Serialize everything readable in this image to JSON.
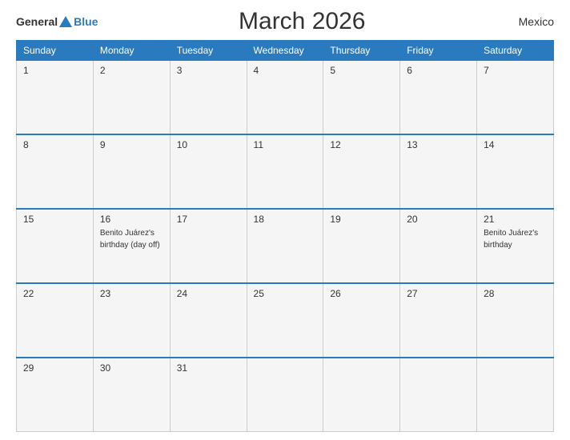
{
  "header": {
    "logo_general": "General",
    "logo_blue": "Blue",
    "title": "March 2026",
    "country": "Mexico"
  },
  "days_of_week": [
    "Sunday",
    "Monday",
    "Tuesday",
    "Wednesday",
    "Thursday",
    "Friday",
    "Saturday"
  ],
  "weeks": [
    [
      {
        "day": "1",
        "event": ""
      },
      {
        "day": "2",
        "event": ""
      },
      {
        "day": "3",
        "event": ""
      },
      {
        "day": "4",
        "event": ""
      },
      {
        "day": "5",
        "event": ""
      },
      {
        "day": "6",
        "event": ""
      },
      {
        "day": "7",
        "event": ""
      }
    ],
    [
      {
        "day": "8",
        "event": ""
      },
      {
        "day": "9",
        "event": ""
      },
      {
        "day": "10",
        "event": ""
      },
      {
        "day": "11",
        "event": ""
      },
      {
        "day": "12",
        "event": ""
      },
      {
        "day": "13",
        "event": ""
      },
      {
        "day": "14",
        "event": ""
      }
    ],
    [
      {
        "day": "15",
        "event": ""
      },
      {
        "day": "16",
        "event": "Benito Juárez's birthday (day off)"
      },
      {
        "day": "17",
        "event": ""
      },
      {
        "day": "18",
        "event": ""
      },
      {
        "day": "19",
        "event": ""
      },
      {
        "day": "20",
        "event": ""
      },
      {
        "day": "21",
        "event": "Benito Juárez's birthday"
      }
    ],
    [
      {
        "day": "22",
        "event": ""
      },
      {
        "day": "23",
        "event": ""
      },
      {
        "day": "24",
        "event": ""
      },
      {
        "day": "25",
        "event": ""
      },
      {
        "day": "26",
        "event": ""
      },
      {
        "day": "27",
        "event": ""
      },
      {
        "day": "28",
        "event": ""
      }
    ],
    [
      {
        "day": "29",
        "event": ""
      },
      {
        "day": "30",
        "event": ""
      },
      {
        "day": "31",
        "event": ""
      },
      {
        "day": "",
        "event": ""
      },
      {
        "day": "",
        "event": ""
      },
      {
        "day": "",
        "event": ""
      },
      {
        "day": "",
        "event": ""
      }
    ]
  ]
}
